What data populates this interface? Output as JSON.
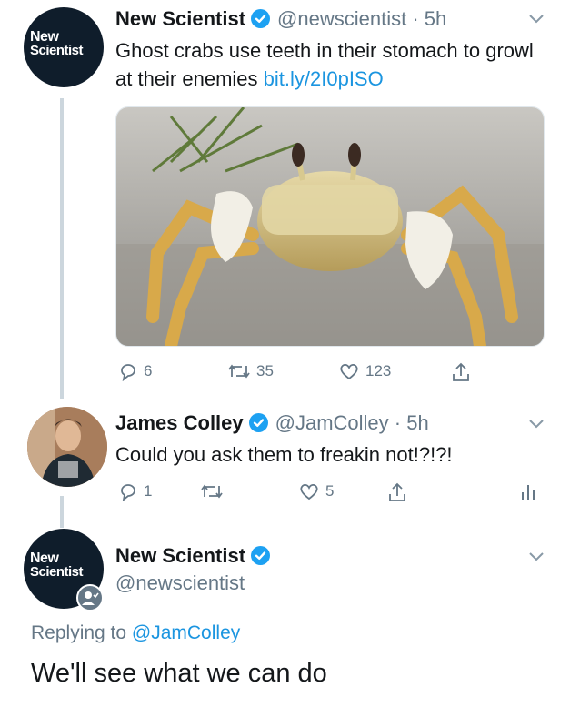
{
  "tweet1": {
    "name": "New Scientist",
    "handle": "@newscientist",
    "time": "5h",
    "text": "Ghost crabs use teeth in their stomach to growl at their enemies",
    "link": "bit.ly/2I0pISO",
    "avatar_logo": [
      "New",
      "Scientist"
    ],
    "image_alt_icon": "crab-photo",
    "actions": {
      "replies": "6",
      "retweets": "35",
      "likes": "123"
    }
  },
  "tweet2": {
    "name": "James Colley",
    "handle": "@JamColley",
    "time": "5h",
    "text": "Could you ask them to freakin not!?!?!",
    "actions": {
      "replies": "1",
      "retweets": "",
      "likes": "5"
    }
  },
  "tweet3": {
    "name": "New Scientist",
    "handle": "@newscientist",
    "avatar_logo": [
      "New",
      "Scientist"
    ],
    "replying_prefix": "Replying to",
    "replying_handle": "@JamColley",
    "text": "We'll see what we can do"
  },
  "colors": {
    "link": "#1b95e0",
    "verified": "#1da1f2",
    "muted": "#657786",
    "avatar": "#0f1d2b"
  }
}
